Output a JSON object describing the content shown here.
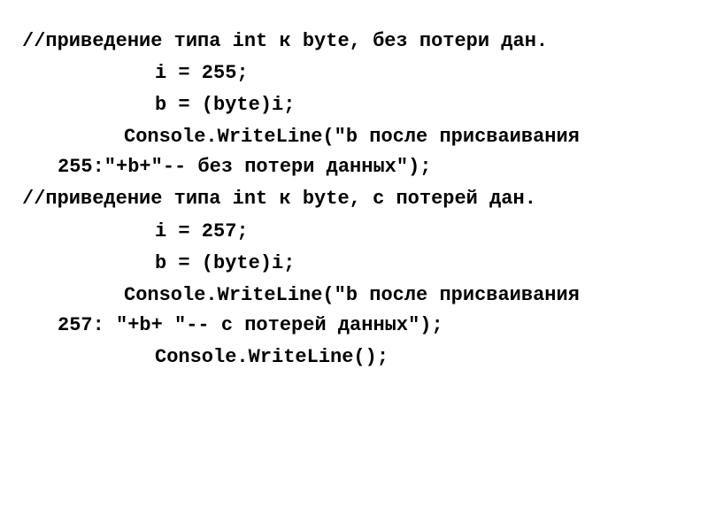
{
  "lines": {
    "comment1": "//приведение типа int к byte, без потери дан.",
    "assign_i_255": "i = 255;",
    "assign_b_cast1": "b = (byte)i;",
    "console_write1a": "Console.WriteLine(\"b после присваивания",
    "console_write1b": "255:\"+b+\"-- без потери данных\");",
    "comment2": "//приведение типа int к byte, с потерей дан.",
    "assign_i_257": "i = 257;",
    "assign_b_cast2": "b = (byte)i;",
    "console_write2a": "Console.WriteLine(\"b после присваивания",
    "console_write2b": "257: \"+b+ \"-- с потерей данных\");",
    "console_writeline_empty": "Console.WriteLine();"
  }
}
